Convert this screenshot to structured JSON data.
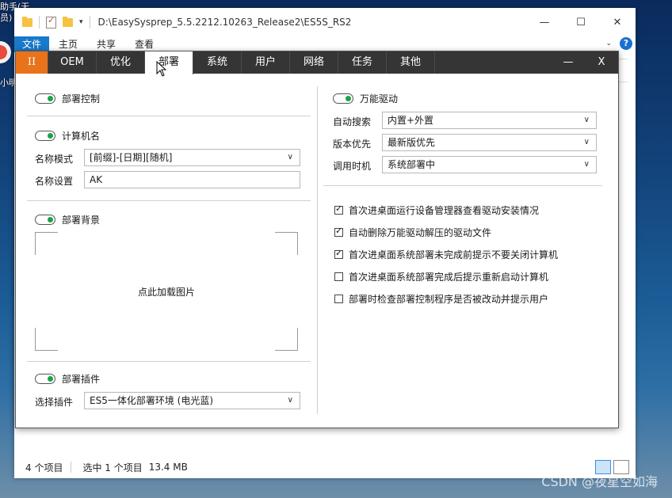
{
  "desktop": {
    "left_text_1": "助手(无",
    "left_text_2": "员)",
    "left_text_3": "小明",
    "watermark": "CSDN @夜星空如海"
  },
  "explorer": {
    "path": "D:\\EasySysprep_5.5.2212.10263_Release2\\ES5S_RS2",
    "ribbon_tabs": [
      "文件",
      "主页",
      "共享",
      "查看"
    ],
    "status_items": "4 个项目",
    "status_selected": "选中 1 个项目",
    "status_size": "13.4 MB",
    "minimize": "—",
    "maximize": "☐",
    "close": "✕"
  },
  "dialog": {
    "logo": "II",
    "tabs": [
      "OEM",
      "优化",
      "部署",
      "系统",
      "用户",
      "网络",
      "任务",
      "其他"
    ],
    "active_tab": "部署",
    "minimize": "—",
    "close": "X",
    "left": {
      "deploy_control": "部署控制",
      "computer_name": "计算机名",
      "name_mode_label": "名称模式",
      "name_mode_value": "[前缀]-[日期][随机]",
      "name_setting_label": "名称设置",
      "name_setting_value": "AK",
      "deploy_background": "部署背景",
      "load_image": "点此加载图片",
      "deploy_plugin": "部署插件",
      "select_plugin_label": "选择插件",
      "select_plugin_value": "ES5一体化部署环境 (电光蓝)"
    },
    "right": {
      "universal_driver": "万能驱动",
      "auto_search_label": "自动搜索",
      "auto_search_value": "内置+外置",
      "version_priority_label": "版本优先",
      "version_priority_value": "最新版优先",
      "call_timing_label": "调用时机",
      "call_timing_value": "系统部署中",
      "checkboxes": [
        {
          "label": "首次进桌面运行设备管理器查看驱动安装情况",
          "checked": true
        },
        {
          "label": "自动删除万能驱动解压的驱动文件",
          "checked": true
        },
        {
          "label": "首次进桌面系统部署未完成前提示不要关闭计算机",
          "checked": true
        },
        {
          "label": "首次进桌面系统部署完成后提示重新启动计算机",
          "checked": false
        },
        {
          "label": "部署时检查部署控制程序是否被改动并提示用户",
          "checked": false
        }
      ]
    }
  },
  "colors": {
    "accent": "#1979ca",
    "logo_tab": "#e8731b",
    "tab_bar": "#353535",
    "toggle_on": "#1aa34a"
  }
}
